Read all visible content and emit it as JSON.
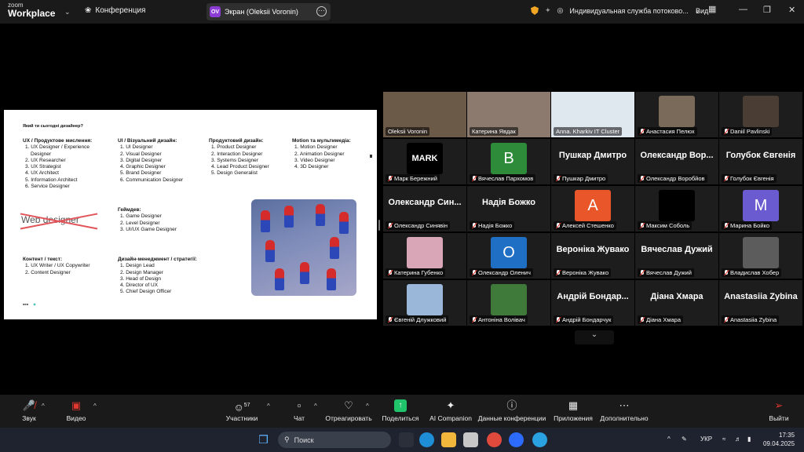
{
  "topbar": {
    "logo_small": "zoom",
    "logo_big": "Workplace",
    "meeting_label": "Конференция",
    "share_badge": "OV",
    "share_label": "Экран (Oleksii Voronin)",
    "stream_label": "Индивидуальная служба потоково...",
    "view_label": "Вид",
    "colors": {
      "bar": "#1a1a1a",
      "badge": "#8a3cd4",
      "shield": "#f2a623"
    }
  },
  "slide": {
    "question": "Який ти сьогодні дизайнер?",
    "columns": [
      {
        "heading": "UX / Продуктове мислення:",
        "items": [
          "1. UX Designer / Experience",
          "   Designer",
          "2. UX Researcher",
          "3. UX Strategist",
          "4. UX Architect",
          "5. Information Architect",
          "6. Service Designer"
        ]
      },
      {
        "heading": "UI / Візуальний дизайн:",
        "items": [
          "1. UI Designer",
          "2. Visual Designer",
          "3. Digital Designer",
          "4. Graphic Designer",
          "5. Brand Designer",
          "6. Communication Designer"
        ]
      },
      {
        "heading": "Продуктовий дизайн:",
        "items": [
          "1. Product Designer",
          "2. Interaction Designer",
          "3. Systems Designer",
          "4. Lead Product Designer",
          "5. Design Generalist"
        ]
      },
      {
        "heading": "Motion та мультимедіа:",
        "items": [
          "1. Motion Designer",
          "2. Animation Designer",
          "3. Video Designer",
          "4. 3D Designer"
        ]
      },
      {
        "heading": "Геймдев:",
        "items": [
          "1. Game Designer",
          "2. Level Designer",
          "3. UI/UX Game Designer"
        ]
      },
      {
        "heading": "Контент / текст:",
        "items": [
          "1. UX Writer / UX Copywriter",
          "2. Content Designer"
        ]
      },
      {
        "heading": "Дизайн-менеджмент / стратегії:",
        "items": [
          "1. Design Lead",
          "2. Design Manager",
          "3. Head of Design",
          "4. Director of UX",
          "5. Chief Design Officer"
        ]
      }
    ],
    "struck_text": "Web designer",
    "strike_color": "#e2545a"
  },
  "participants": [
    {
      "name": "Oleksii Voronin",
      "type": "video",
      "muted": false,
      "bg": "#6b5a48"
    },
    {
      "name": "Катерина Явдак",
      "type": "video",
      "muted": false,
      "speaking": true,
      "bg": "#8c7a6e"
    },
    {
      "name": "Anna. Kharkiv IT Cluster",
      "type": "video",
      "muted": false,
      "bg": "#dfe7ef"
    },
    {
      "name": "Анастасия Пелюх",
      "type": "photo",
      "muted": true,
      "bg": "#7a6a5a"
    },
    {
      "name": "Daniil Pavlinski",
      "type": "photo",
      "muted": true,
      "bg": "#4a3d33"
    },
    {
      "name": "Марк Бережний",
      "type": "photo",
      "muted": true,
      "bg": "#000000",
      "avatar_text": "MARK"
    },
    {
      "name": "Вячеслав Пархомов",
      "type": "letter",
      "muted": true,
      "bg": "#2e8b3a",
      "avatar_text": "B"
    },
    {
      "name": "Пушкар Дмитро",
      "type": "name",
      "muted": true,
      "big": "Пушкар Дмитро"
    },
    {
      "name": "Олександр Воробйов",
      "type": "name",
      "muted": true,
      "big": "Олександр Вор..."
    },
    {
      "name": "Голубок Євгенія",
      "type": "name",
      "muted": true,
      "big": "Голубок Євгенія"
    },
    {
      "name": "Олександр Синявін",
      "type": "name",
      "muted": true,
      "big": "Олександр Син..."
    },
    {
      "name": "Надія Божко",
      "type": "name",
      "muted": true,
      "big": "Надія Божко"
    },
    {
      "name": "Алексей Стешенко",
      "type": "letter",
      "muted": true,
      "bg": "#e8562a",
      "avatar_text": "A"
    },
    {
      "name": "Максим Соболь",
      "type": "photo",
      "muted": true,
      "bg": "#000000"
    },
    {
      "name": "Марина Бойко",
      "type": "letter",
      "muted": true,
      "bg": "#6a5bd0",
      "avatar_text": "M"
    },
    {
      "name": "Катерина Губенко",
      "type": "photo",
      "muted": true,
      "bg": "#d9a6b8"
    },
    {
      "name": "Олександр Оленич",
      "type": "letter",
      "muted": true,
      "bg": "#1f6fc4",
      "avatar_text": "O"
    },
    {
      "name": "Вероніка Жувако",
      "type": "name",
      "muted": true,
      "big": "Вероніка Жувако"
    },
    {
      "name": "Вячеслав Дужий",
      "type": "name",
      "muted": true,
      "big": "Вячеслав Дужий"
    },
    {
      "name": "Владислав Хобер",
      "type": "photo",
      "muted": true,
      "bg": "#5c5c5c"
    },
    {
      "name": "Євгеній Длужковий",
      "type": "photo",
      "muted": true,
      "bg": "#9ab7d9"
    },
    {
      "name": "Антоніна Волівач",
      "type": "photo",
      "muted": true,
      "bg": "#3f7a3a"
    },
    {
      "name": "Андрій Бондарчук",
      "type": "name",
      "muted": true,
      "big": "Андрій Бондар..."
    },
    {
      "name": "Діана Хмара",
      "type": "name",
      "muted": true,
      "big": "Діана Хмара"
    },
    {
      "name": "Anastasiia Zybina",
      "type": "name",
      "muted": true,
      "big": "Anastasiia Zybina"
    }
  ],
  "toolbar": {
    "audio": "Звук",
    "video": "Видео",
    "participants": "Участники",
    "participants_count": "57",
    "chat": "Чат",
    "react": "Отреагировать",
    "share": "Поделиться",
    "ai": "AI Companion",
    "info": "Данные конференции",
    "apps": "Приложения",
    "more": "Дополнительно",
    "leave": "Выйти",
    "colors": {
      "mute": "#e0372e",
      "share": "#20c46b"
    }
  },
  "taskbar": {
    "search_placeholder": "Поиск",
    "lang": "УКР",
    "time": "17:35",
    "date": "09.04.2025"
  }
}
